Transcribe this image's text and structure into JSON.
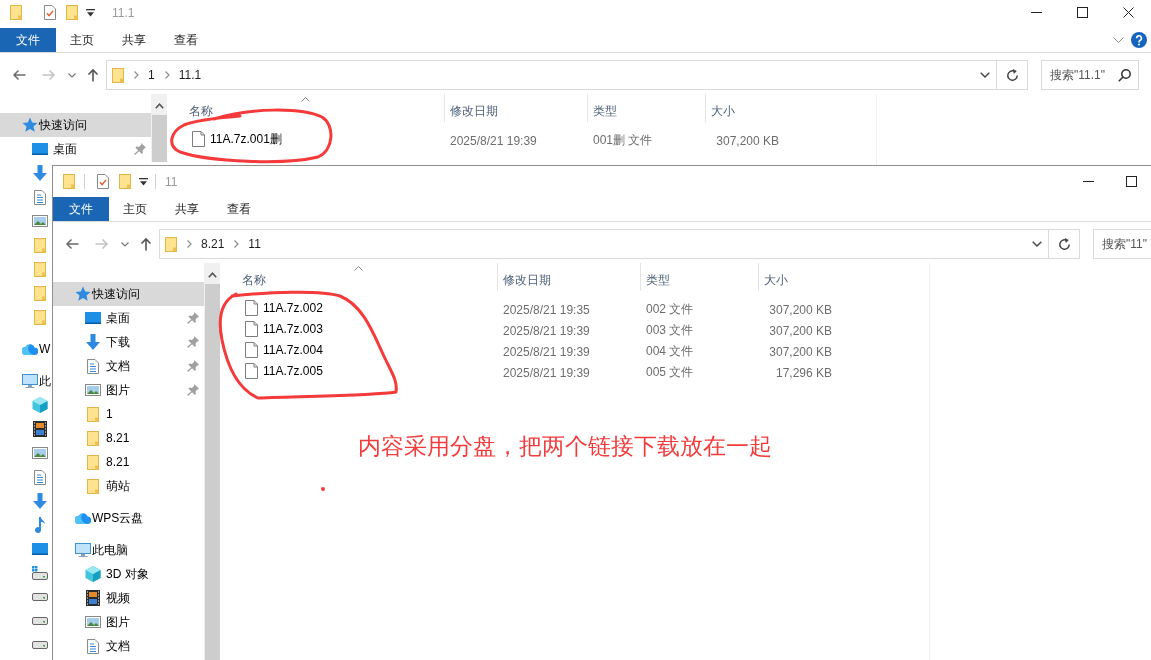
{
  "windows": [
    {
      "kind": "whole",
      "title": "11.1",
      "controls": [
        {
          "kind": "minimize"
        },
        {
          "kind": "maximize"
        },
        {
          "kind": "close"
        }
      ],
      "ribbon": {
        "tabs": [
          {
            "label": "文件",
            "kind": "file"
          },
          {
            "label": "主页",
            "kind": "tab"
          },
          {
            "label": "共享",
            "kind": "tab"
          },
          {
            "label": "查看",
            "kind": "tab"
          }
        ],
        "extras": [
          {
            "kind": "collapse"
          },
          {
            "kind": "help"
          }
        ]
      },
      "address": {
        "path": [
          "1",
          "11.1"
        ]
      },
      "search": {
        "placeholder": "搜索\"11.1\""
      },
      "nav": [
        {
          "label": "快速访问",
          "kind": "star",
          "selected": true,
          "pinned": false,
          "children": [
            {
              "label": "桌面",
              "kind": "desktop",
              "selected": false,
              "pinned": true
            },
            {
              "kind": "download",
              "selected": false,
              "pinned": false
            },
            {
              "kind": "document",
              "selected": false,
              "pinned": false
            },
            {
              "kind": "pictures",
              "selected": false,
              "pinned": false
            },
            {
              "kind": "folder",
              "selected": false,
              "pinned": false
            },
            {
              "kind": "folder",
              "selected": false,
              "pinned": false
            },
            {
              "kind": "folder",
              "selected": false,
              "pinned": false
            },
            {
              "kind": "folder",
              "selected": false,
              "pinned": false
            }
          ]
        },
        {
          "label": "W",
          "kind": "cloud",
          "selected": false,
          "pinned": false
        },
        {
          "label": "此",
          "kind": "pc",
          "selected": false,
          "pinned": false,
          "children": [
            {
              "kind": "cube",
              "selected": false,
              "pinned": false
            },
            {
              "kind": "video",
              "selected": false,
              "pinned": false
            },
            {
              "kind": "pictures",
              "selected": false,
              "pinned": false
            },
            {
              "kind": "document",
              "selected": false,
              "pinned": false
            },
            {
              "kind": "download",
              "selected": false,
              "pinned": false
            },
            {
              "kind": "music",
              "selected": false,
              "pinned": false
            },
            {
              "kind": "desktop",
              "selected": false,
              "pinned": false
            },
            {
              "kind": "system_drive",
              "selected": false,
              "pinned": false
            },
            {
              "kind": "drive",
              "selected": false,
              "pinned": false
            },
            {
              "kind": "drive",
              "selected": false,
              "pinned": false
            },
            {
              "kind": "drive",
              "selected": false,
              "pinned": false
            }
          ]
        }
      ],
      "columns": [
        {
          "label": "名称",
          "sorted": true
        },
        {
          "label": "修改日期",
          "sorted": false
        },
        {
          "label": "类型",
          "sorted": false
        },
        {
          "label": "大小",
          "sorted": false
        }
      ],
      "files": [
        {
          "name": "11A.7z.001删",
          "modified": "2025/8/21 19:39",
          "type": "001删 文件",
          "size": "307,200 KB"
        }
      ]
    },
    {
      "kind": "clipped",
      "title": "11",
      "controls": [
        {
          "kind": "minimize"
        },
        {
          "kind": "maximize"
        }
      ],
      "ribbon": {
        "tabs": [
          {
            "label": "文件",
            "kind": "file"
          },
          {
            "label": "主页",
            "kind": "tab"
          },
          {
            "label": "共享",
            "kind": "tab"
          },
          {
            "label": "查看",
            "kind": "tab"
          }
        ]
      },
      "address": {
        "path": [
          "8.21",
          "11"
        ]
      },
      "search": {
        "placeholder": "搜索\"11\""
      },
      "nav": [
        {
          "label": "快速访问",
          "kind": "star",
          "selected": true,
          "pinned": false,
          "children": [
            {
              "label": "桌面",
              "kind": "desktop",
              "selected": false,
              "pinned": true
            },
            {
              "label": "下载",
              "kind": "download",
              "selected": false,
              "pinned": true
            },
            {
              "label": "文档",
              "kind": "document",
              "selected": false,
              "pinned": true
            },
            {
              "label": "图片",
              "kind": "pictures",
              "selected": false,
              "pinned": true
            },
            {
              "label": "1",
              "kind": "folder",
              "selected": false,
              "pinned": false
            },
            {
              "label": "8.21",
              "kind": "folder",
              "selected": false,
              "pinned": false
            },
            {
              "label": "8.21",
              "kind": "folder",
              "selected": false,
              "pinned": false
            },
            {
              "label": "萌站",
              "kind": "folder",
              "selected": false,
              "pinned": false
            }
          ]
        },
        {
          "label": "WPS云盘",
          "kind": "cloud",
          "selected": false,
          "pinned": false
        },
        {
          "label": "此电脑",
          "kind": "pc",
          "selected": false,
          "pinned": false,
          "children": [
            {
              "label": "3D 对象",
              "kind": "cube",
              "selected": false,
              "pinned": false
            },
            {
              "label": "视频",
              "kind": "video",
              "selected": false,
              "pinned": false
            },
            {
              "label": "图片",
              "kind": "pictures",
              "selected": false,
              "pinned": false
            },
            {
              "label": "文档",
              "kind": "document",
              "selected": false,
              "pinned": false
            }
          ]
        }
      ],
      "columns": [
        {
          "label": "名称",
          "sorted": true
        },
        {
          "label": "修改日期",
          "sorted": false
        },
        {
          "label": "类型",
          "sorted": false
        },
        {
          "label": "大小",
          "sorted": false
        }
      ],
      "files": [
        {
          "name": "11A.7z.002",
          "modified": "2025/8/21 19:35",
          "type": "002 文件",
          "size": "307,200 KB"
        },
        {
          "name": "11A.7z.003",
          "modified": "2025/8/21 19:39",
          "type": "003 文件",
          "size": "307,200 KB"
        },
        {
          "name": "11A.7z.004",
          "modified": "2025/8/21 19:39",
          "type": "004 文件",
          "size": "307,200 KB"
        },
        {
          "name": "11A.7z.005",
          "modified": "2025/8/21 19:39",
          "type": "005 文件",
          "size": "17,296 KB"
        }
      ]
    }
  ],
  "annotation": {
    "note": "内容采用分盘，把两个链接下载放在一起"
  }
}
